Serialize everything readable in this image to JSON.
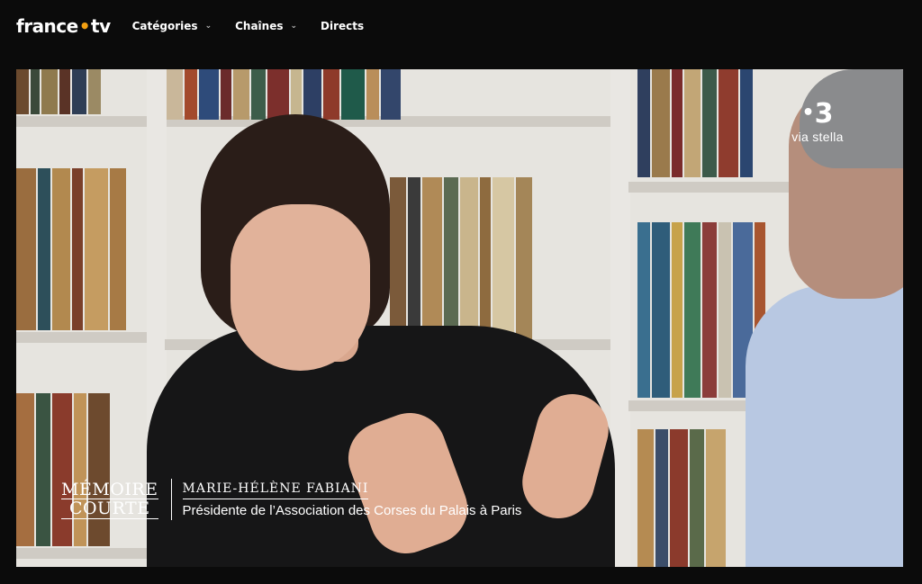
{
  "header": {
    "logo_prefix": "france",
    "logo_dot": "•",
    "logo_suffix": "tv",
    "nav": [
      {
        "label": "Catégories",
        "has_dropdown": true
      },
      {
        "label": "Chaînes",
        "has_dropdown": true
      },
      {
        "label": "Directs",
        "has_dropdown": false
      }
    ]
  },
  "player": {
    "channel_number": "3",
    "channel_bullet": "•",
    "channel_name": "via stella",
    "show_title_line1": "MÉMOIRE",
    "show_title_line2": "COURTE",
    "guest_name": "MARIE-HÉLÈNE FABIANI",
    "guest_role": "Présidente de l’Association des Corses du Palais à Paris"
  },
  "colors": {
    "background": "#0b0b0b",
    "logo_accent": "#f3a012",
    "text": "#ffffff"
  }
}
